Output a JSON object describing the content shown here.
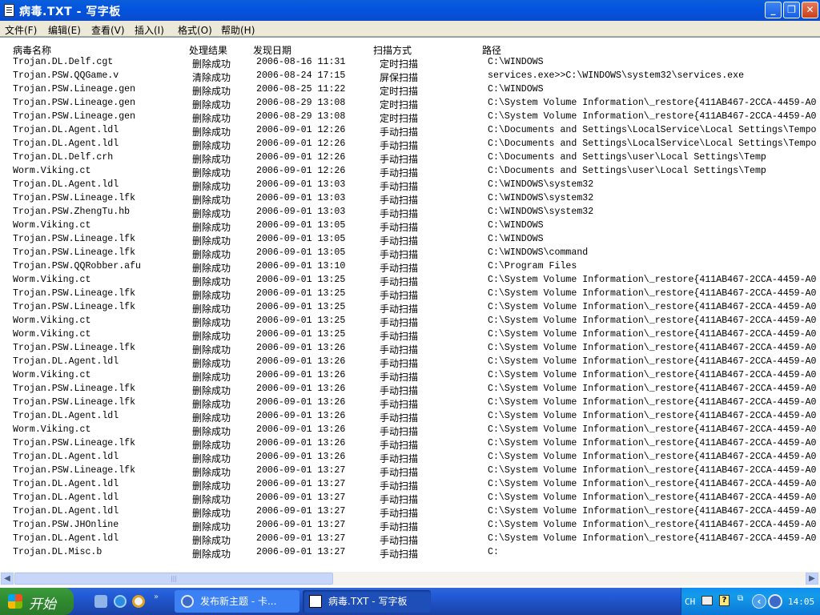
{
  "window": {
    "title": "病毒.TXT - 写字板",
    "minimize_icon": "minimize-icon",
    "maximize_icon": "restore-icon",
    "close_icon": "close-icon"
  },
  "menu": [
    "文件(F)",
    "编辑(E)",
    "查看(V)",
    "插入(I)",
    "格式(O)",
    "帮助(H)"
  ],
  "columns": [
    "病毒名称",
    "处理结果",
    "发现日期",
    "扫描方式",
    "路径"
  ],
  "rows": [
    [
      "Trojan.DL.Delf.cgt",
      "删除成功",
      "2006-08-16 11:31",
      "定时扫描",
      "C:\\WINDOWS"
    ],
    [
      "Trojan.PSW.QQGame.v",
      "清除成功",
      "2006-08-24 17:15",
      "屏保扫描",
      "services.exe>>C:\\WINDOWS\\system32\\services.exe"
    ],
    [
      "Trojan.PSW.Lineage.gen",
      "删除成功",
      "2006-08-25 11:22",
      "定时扫描",
      "C:\\WINDOWS"
    ],
    [
      "Trojan.PSW.Lineage.gen",
      "删除成功",
      "2006-08-29 13:08",
      "定时扫描",
      "C:\\System Volume Information\\_restore{411AB467-2CCA-4459-A0"
    ],
    [
      "Trojan.PSW.Lineage.gen",
      "删除成功",
      "2006-08-29 13:08",
      "定时扫描",
      "C:\\System Volume Information\\_restore{411AB467-2CCA-4459-A0"
    ],
    [
      "Trojan.DL.Agent.ldl",
      "删除成功",
      "2006-09-01 12:26",
      "手动扫描",
      "C:\\Documents and Settings\\LocalService\\Local Settings\\Tempo"
    ],
    [
      "Trojan.DL.Agent.ldl",
      "删除成功",
      "2006-09-01 12:26",
      "手动扫描",
      "C:\\Documents and Settings\\LocalService\\Local Settings\\Tempo"
    ],
    [
      "Trojan.DL.Delf.crh",
      "删除成功",
      "2006-09-01 12:26",
      "手动扫描",
      "C:\\Documents and Settings\\user\\Local Settings\\Temp"
    ],
    [
      "Worm.Viking.ct",
      "删除成功",
      "2006-09-01 12:26",
      "手动扫描",
      "C:\\Documents and Settings\\user\\Local Settings\\Temp"
    ],
    [
      "Trojan.DL.Agent.ldl",
      "删除成功",
      "2006-09-01 13:03",
      "手动扫描",
      "C:\\WINDOWS\\system32"
    ],
    [
      "Trojan.PSW.Lineage.lfk",
      "删除成功",
      "2006-09-01 13:03",
      "手动扫描",
      "C:\\WINDOWS\\system32"
    ],
    [
      "Trojan.PSW.ZhengTu.hb",
      "删除成功",
      "2006-09-01 13:03",
      "手动扫描",
      "C:\\WINDOWS\\system32"
    ],
    [
      "Worm.Viking.ct",
      "删除成功",
      "2006-09-01 13:05",
      "手动扫描",
      "C:\\WINDOWS"
    ],
    [
      "Trojan.PSW.Lineage.lfk",
      "删除成功",
      "2006-09-01 13:05",
      "手动扫描",
      "C:\\WINDOWS"
    ],
    [
      "Trojan.PSW.Lineage.lfk",
      "删除成功",
      "2006-09-01 13:05",
      "手动扫描",
      "C:\\WINDOWS\\command"
    ],
    [
      "Trojan.PSW.QQRobber.afu",
      "删除成功",
      "2006-09-01 13:10",
      "手动扫描",
      "C:\\Program Files"
    ],
    [
      "Worm.Viking.ct",
      "删除成功",
      "2006-09-01 13:25",
      "手动扫描",
      "C:\\System Volume Information\\_restore{411AB467-2CCA-4459-A0"
    ],
    [
      "Trojan.PSW.Lineage.lfk",
      "删除成功",
      "2006-09-01 13:25",
      "手动扫描",
      "C:\\System Volume Information\\_restore{411AB467-2CCA-4459-A0"
    ],
    [
      "Trojan.PSW.Lineage.lfk",
      "删除成功",
      "2006-09-01 13:25",
      "手动扫描",
      "C:\\System Volume Information\\_restore{411AB467-2CCA-4459-A0"
    ],
    [
      "Worm.Viking.ct",
      "删除成功",
      "2006-09-01 13:25",
      "手动扫描",
      "C:\\System Volume Information\\_restore{411AB467-2CCA-4459-A0"
    ],
    [
      "Worm.Viking.ct",
      "删除成功",
      "2006-09-01 13:25",
      "手动扫描",
      "C:\\System Volume Information\\_restore{411AB467-2CCA-4459-A0"
    ],
    [
      "Trojan.PSW.Lineage.lfk",
      "删除成功",
      "2006-09-01 13:26",
      "手动扫描",
      "C:\\System Volume Information\\_restore{411AB467-2CCA-4459-A0"
    ],
    [
      "Trojan.DL.Agent.ldl",
      "删除成功",
      "2006-09-01 13:26",
      "手动扫描",
      "C:\\System Volume Information\\_restore{411AB467-2CCA-4459-A0"
    ],
    [
      "Worm.Viking.ct",
      "删除成功",
      "2006-09-01 13:26",
      "手动扫描",
      "C:\\System Volume Information\\_restore{411AB467-2CCA-4459-A0"
    ],
    [
      "Trojan.PSW.Lineage.lfk",
      "删除成功",
      "2006-09-01 13:26",
      "手动扫描",
      "C:\\System Volume Information\\_restore{411AB467-2CCA-4459-A0"
    ],
    [
      "Trojan.PSW.Lineage.lfk",
      "删除成功",
      "2006-09-01 13:26",
      "手动扫描",
      "C:\\System Volume Information\\_restore{411AB467-2CCA-4459-A0"
    ],
    [
      "Trojan.DL.Agent.ldl",
      "删除成功",
      "2006-09-01 13:26",
      "手动扫描",
      "C:\\System Volume Information\\_restore{411AB467-2CCA-4459-A0"
    ],
    [
      "Worm.Viking.ct",
      "删除成功",
      "2006-09-01 13:26",
      "手动扫描",
      "C:\\System Volume Information\\_restore{411AB467-2CCA-4459-A0"
    ],
    [
      "Trojan.PSW.Lineage.lfk",
      "删除成功",
      "2006-09-01 13:26",
      "手动扫描",
      "C:\\System Volume Information\\_restore{411AB467-2CCA-4459-A0"
    ],
    [
      "Trojan.DL.Agent.ldl",
      "删除成功",
      "2006-09-01 13:26",
      "手动扫描",
      "C:\\System Volume Information\\_restore{411AB467-2CCA-4459-A0"
    ],
    [
      "Trojan.PSW.Lineage.lfk",
      "删除成功",
      "2006-09-01 13:27",
      "手动扫描",
      "C:\\System Volume Information\\_restore{411AB467-2CCA-4459-A0"
    ],
    [
      "Trojan.DL.Agent.ldl",
      "删除成功",
      "2006-09-01 13:27",
      "手动扫描",
      "C:\\System Volume Information\\_restore{411AB467-2CCA-4459-A0"
    ],
    [
      "Trojan.DL.Agent.ldl",
      "删除成功",
      "2006-09-01 13:27",
      "手动扫描",
      "C:\\System Volume Information\\_restore{411AB467-2CCA-4459-A0"
    ],
    [
      "Trojan.DL.Agent.ldl",
      "删除成功",
      "2006-09-01 13:27",
      "手动扫描",
      "C:\\System Volume Information\\_restore{411AB467-2CCA-4459-A0"
    ],
    [
      "Trojan.PSW.JHOnline",
      "删除成功",
      "2006-09-01 13:27",
      "手动扫描",
      "C:\\System Volume Information\\_restore{411AB467-2CCA-4459-A0"
    ],
    [
      "Trojan.DL.Agent.ldl",
      "删除成功",
      "2006-09-01 13:27",
      "手动扫描",
      "C:\\System Volume Information\\_restore{411AB467-2CCA-4459-A0"
    ],
    [
      "Trojan.DL.Misc.b",
      "删除成功",
      "2006-09-01 13:27",
      "手动扫描",
      "C:"
    ]
  ],
  "taskbar": {
    "start_label": "开始",
    "tasks": [
      "发布新主题 - 卡...",
      "病毒.TXT - 写字板"
    ],
    "tray": {
      "lang": "CH",
      "clock": "14:05"
    }
  }
}
